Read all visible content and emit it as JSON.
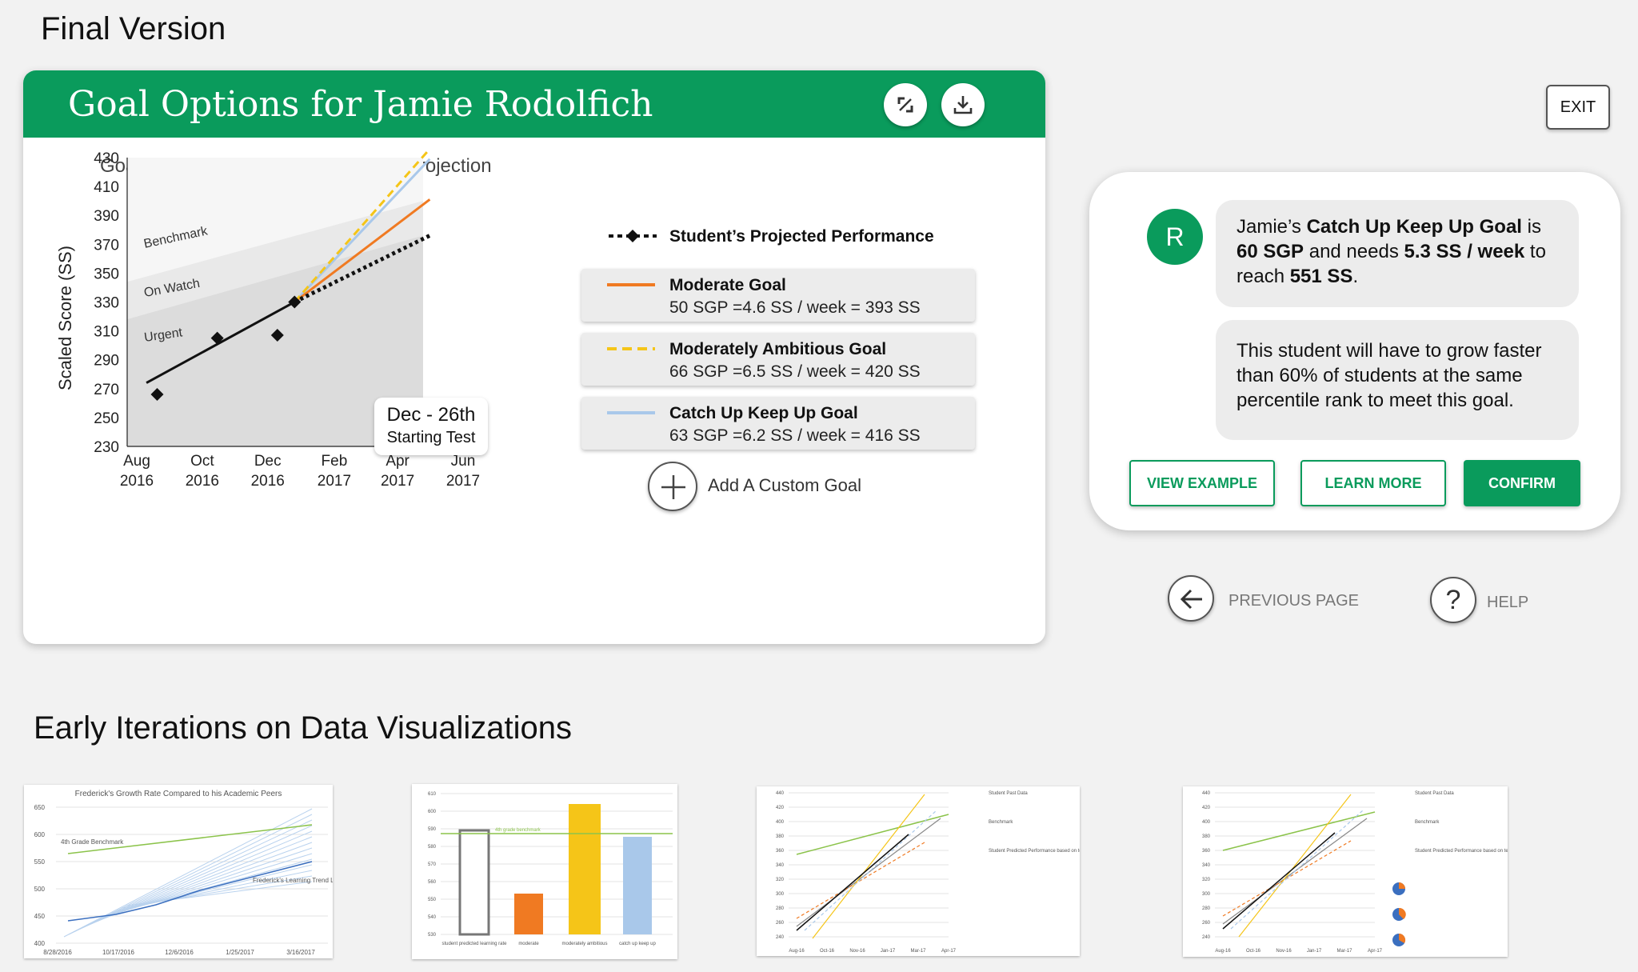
{
  "page": {
    "heading_final": "Final Version",
    "heading_early": "Early Iterations on Data Visualizations"
  },
  "card": {
    "title": "Goal Options for Jamie Rodolfich",
    "expand_icon": "expand-icon",
    "download_icon": "download-icon"
  },
  "chart_data": {
    "type": "line",
    "title": "Goal Setting with Low Performance Projection",
    "ylabel": "Scaled Score (SS)",
    "ylim": [
      230,
      430
    ],
    "yticks": [
      430,
      410,
      390,
      370,
      350,
      330,
      310,
      290,
      270,
      250,
      230
    ],
    "xticks": [
      {
        "month": "Aug",
        "year": "2016",
        "x": "2016-08"
      },
      {
        "month": "Oct",
        "year": "2016",
        "x": "2016-10"
      },
      {
        "month": "Dec",
        "year": "2016",
        "x": "2016-12"
      },
      {
        "month": "Feb",
        "year": "2017",
        "x": "2017-02"
      },
      {
        "month": "Apr",
        "year": "2017",
        "x": "2017-04"
      },
      {
        "month": "Jun",
        "year": "2017",
        "x": "2017-06"
      }
    ],
    "zones": [
      "Benchmark",
      "On Watch",
      "Urgent"
    ],
    "past_scores": [
      {
        "x": "2016-08-20",
        "y": 266
      },
      {
        "x": "2016-10-15",
        "y": 305
      },
      {
        "x": "2016-12-10",
        "y": 307
      },
      {
        "x": "2016-12-26",
        "y": 330
      }
    ],
    "trend_line": [
      {
        "x": "2016-08-10",
        "y": 274
      },
      {
        "x": "2016-12-26",
        "y": 330
      }
    ],
    "starting_test": {
      "date": "Dec - 26th",
      "label": "Starting Test"
    },
    "series": [
      {
        "name": "Student's Projected Performance",
        "color": "#111111",
        "style": "dotted",
        "end": {
          "x": "2017-05",
          "y": 376
        }
      },
      {
        "name": "Moderate Goal",
        "color": "#f07a22",
        "style": "solid",
        "end": {
          "x": "2017-05",
          "y": 401
        }
      },
      {
        "name": "Moderately Ambitious Goal",
        "color": "#f5c518",
        "style": "dashed",
        "end": {
          "x": "2017-05",
          "y": 436
        }
      },
      {
        "name": "Catch Up Keep Up Goal",
        "color": "#a9c8ea",
        "style": "solid",
        "end": {
          "x": "2017-05",
          "y": 429
        }
      }
    ]
  },
  "legend": {
    "projected": "Student’s Projected Performance",
    "items": [
      {
        "name": "Moderate Goal",
        "detail": "50 SGP =4.6 SS / week = 393 SS",
        "color": "#f07a22",
        "style": "solid"
      },
      {
        "name": "Moderately Ambitious Goal",
        "detail": "66 SGP =6.5 SS / week = 420 SS",
        "color": "#f5c518",
        "style": "dashed"
      },
      {
        "name": "Catch Up Keep Up Goal",
        "detail": "63 SGP =6.2 SS / week = 416 SS",
        "color": "#a9c8ea",
        "style": "solid"
      }
    ],
    "add_custom": "Add A Custom Goal"
  },
  "panel": {
    "avatar_letter": "R",
    "msg1": {
      "p1": "Jamie’s ",
      "b1": "Catch Up Keep Up Goal",
      "p2": " is",
      "b2": "60 SGP",
      "p3": " and needs ",
      "b3": "5.3 SS / week",
      "p4": " to",
      "p5": "reach ",
      "b4": "551 SS",
      "p6": "."
    },
    "msg2": "This student will have to grow faster than 60% of students at the same percentile rank to meet this goal.",
    "btn_view": "VIEW EXAMPLE",
    "btn_learn": "LEARN MORE",
    "btn_confirm": "CONFIRM"
  },
  "nav": {
    "exit": "EXIT",
    "previous": "PREVIOUS PAGE",
    "help": "HELP"
  },
  "thumbs": {
    "t1": {
      "title": "Frederick's Growth Rate Compared to his Academic Peers",
      "benchmark": "4th Grade Benchmark",
      "trend": "Frederick's Learning Trend Line",
      "yticks": [
        "650",
        "600",
        "550",
        "500",
        "450",
        "400"
      ],
      "xticks": [
        "8/28/2016",
        "10/17/2016",
        "12/6/2016",
        "1/25/2017",
        "3/16/2017"
      ]
    },
    "t2": {
      "yticks": [
        "610",
        "600",
        "590",
        "580",
        "570",
        "560",
        "550",
        "540",
        "530"
      ],
      "benchmark": "4th grade benchmark",
      "xlabels": [
        "student predicted learning rate",
        "moderate",
        "moderately ambitious",
        "catch up keep up"
      ]
    },
    "t3": {
      "yticks": [
        "440",
        "420",
        "400",
        "380",
        "360",
        "340",
        "320",
        "300",
        "280",
        "260",
        "240"
      ],
      "xticks": [
        "Aug-16",
        "Oct-16",
        "Nov-16",
        "Jan-17",
        "Mar-17",
        "Apr-17"
      ],
      "legend": [
        "Student Past Data",
        "Benchmark",
        "Student Predicted Performance based on testing history."
      ]
    },
    "t4": {
      "yticks": [
        "440",
        "420",
        "400",
        "380",
        "360",
        "340",
        "320",
        "300",
        "280",
        "260",
        "240"
      ],
      "xticks": [
        "Aug-16",
        "Oct-16",
        "Nov-16",
        "Jan-17",
        "Mar-17",
        "Apr-17"
      ],
      "legend": [
        "Student Past Data",
        "Benchmark",
        "Student Predicted Performance based on testing history."
      ]
    }
  }
}
